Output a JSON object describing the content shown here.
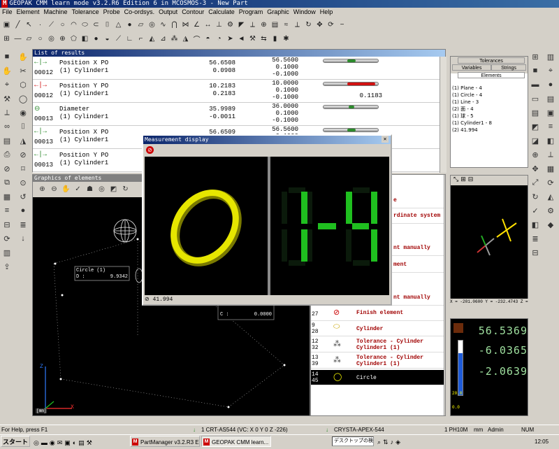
{
  "app": {
    "logo": "M",
    "title": "GEOPAK CMM learn mode v3.2.R6 Edition 6 in MCOSMOS-3 - New Part"
  },
  "menu": [
    "File",
    "Element",
    "Machine",
    "Tolerance",
    "Probe",
    "Co-ordsys.",
    "Output",
    "Contour",
    "Calculate",
    "Program",
    "Graphic",
    "Window",
    "Help"
  ],
  "results": {
    "title": "List of results",
    "rows": [
      {
        "num": "00012",
        "name": "Position X PO\n(1) Cylinder1",
        "actual": "56.6508\n0.0908",
        "nominal": "56.5600\n0.1000\n-0.1000",
        "bar_color": "#2c8a2c",
        "bar_pos": 0.5,
        "deviation": ""
      },
      {
        "num": "00012",
        "name": "Position Y PO\n(1) Cylinder1",
        "actual": "10.2183\n0.2183",
        "nominal": "10.0000\n0.1000\n-0.1000",
        "bar_color": "#d01010",
        "bar_pos": 0.9,
        "deviation": "0.1183"
      },
      {
        "num": "00013",
        "name": "Diameter\n(1) Cylinder1",
        "actual": "35.9989\n-0.0011",
        "nominal": "36.0000\n0.1000\n-0.1000",
        "bar_color": "#2c8a2c",
        "bar_pos": 0.5,
        "deviation": ""
      },
      {
        "num": "00013",
        "name": "Position X PO\n(1) Cylinder1",
        "actual": "56.6509",
        "nominal": "56.5600\n0.1000\n-0.1000",
        "bar_color": "#2c8a2c",
        "bar_pos": 0.5,
        "deviation": ""
      },
      {
        "num": "00013",
        "name": "Position Y PO\n(1) Cylinder1",
        "actual": "",
        "nominal": "",
        "bar_color": "#2c8a2c",
        "bar_pos": 0.5,
        "deviation": ""
      }
    ]
  },
  "graphics": {
    "title": "Graphics of elements",
    "circle_label": "Circle (1)",
    "circle_d_label": "D :",
    "circle_d_value": "9.9342",
    "c_label": "C :",
    "c_value": "0.0000",
    "axis_x": "X",
    "axis_z": "Z",
    "scale": "[mm]"
  },
  "measurement": {
    "title": "Measurement display",
    "digits_fg": "1-4",
    "digits_bg": "8-8",
    "footer": "41.994"
  },
  "program": {
    "partial_labels": [
      "e",
      "rdinate system",
      "nt manually",
      "ment",
      "nt manually"
    ],
    "items": [
      {
        "num": "27",
        "icon": "⊘",
        "label": "Finish element",
        "selected": false
      },
      {
        "num": "9\n28",
        "icon": "⬭",
        "label": "Cylinder",
        "selected": false
      },
      {
        "num": "12\n32",
        "icon": "⁂",
        "label": "Tolerance - Cylinder\nCylinder1 (1)",
        "selected": false
      },
      {
        "num": "13\n39",
        "icon": "⁂",
        "label": "Tolerance - Cylinder\nCylinder1 (1)",
        "selected": false
      },
      {
        "num": "14\n45",
        "icon": "◯",
        "label": "Circle",
        "selected": true
      }
    ]
  },
  "right": {
    "tab_tolerances": "Tolerances",
    "tab_variables": "Variables",
    "tab_strings": "Strings",
    "tab_elements": "Elements",
    "elements": [
      "(1) Plane - 4",
      "(1) Circle - 4",
      "(1) Line - 3",
      "(2) 面 - 4",
      "(1) 球 - 5",
      "(1) Cylinder1 - 8",
      "(2) 41.994"
    ]
  },
  "coords": "X = -201.0600 Y = -232.4743 Z =",
  "dro": {
    "x": "56.5369",
    "y": "-6.0365",
    "z": "-2.0639",
    "scale_top": "20.0",
    "scale_bottom": "0.0"
  },
  "status": {
    "help": "For Help, press F1",
    "probe": "1  CRT-AS544 (VC: X 0 Y 0 Z -226)",
    "machine": "CRYSTA-APEX-544",
    "ph": "1 PH10M",
    "unit": "mm",
    "user": "Admin",
    "num": "NUM"
  },
  "taskbar": {
    "start": "スタート",
    "tasks": [
      "PartManager v3.2.R3 Edi...",
      "GEOPAK CMM learn..."
    ],
    "search": "デスクトップの検索",
    "clock": "12:05"
  }
}
